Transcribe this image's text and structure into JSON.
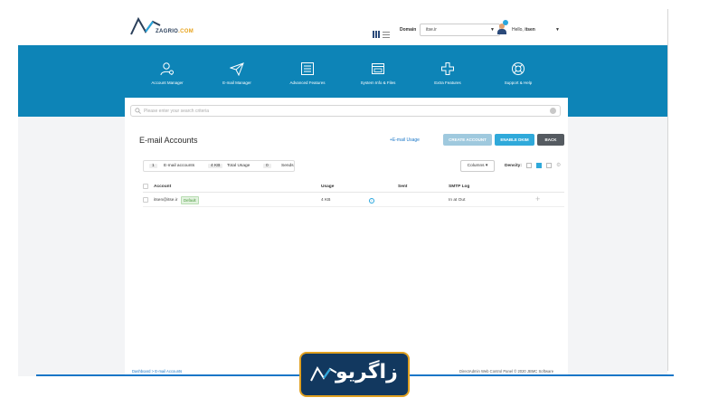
{
  "brand": {
    "logo_text": "ZAGRIO",
    "logo_suffix": ".COM",
    "watermark_text": "زاگریو",
    "colors": {
      "primary": "#0d84b7",
      "accent": "#29a6dd",
      "logo_orange": "#e8a31c",
      "dark": "#555b61"
    }
  },
  "topbar": {
    "view_icons": [
      "grid-icon",
      "list-icon"
    ],
    "domain_label": "Domain",
    "domain_value": "itse.ir",
    "greeting": "Hello,",
    "username": "itsen"
  },
  "nav": {
    "items": [
      {
        "label": "Account Manager",
        "icon": "user-gear-icon"
      },
      {
        "label": "E-mail Manager",
        "icon": "paper-plane-icon"
      },
      {
        "label": "Advanced Features",
        "icon": "list-window-icon"
      },
      {
        "label": "System Info & Files",
        "icon": "folder-window-icon"
      },
      {
        "label": "Extra Features",
        "icon": "plus-icon"
      },
      {
        "label": "Support & Help",
        "icon": "lifebuoy-icon"
      }
    ]
  },
  "search": {
    "placeholder": "Please enter your search criteria"
  },
  "page": {
    "title": "E-mail Accounts",
    "usage_link": "+E-mail Usage",
    "buttons": {
      "create": "CREATE ACCOUNT",
      "dkim": "ENABLE DKIM",
      "back": "BACK"
    }
  },
  "stats": {
    "accounts_count": "1",
    "accounts_label": "E-mail accounts",
    "usage_value": "4 KB",
    "usage_label": "Total Usage",
    "sends_count": "0",
    "sends_label": "Sends"
  },
  "toolbar": {
    "columns_label": "Columns",
    "density_label": "Density:"
  },
  "table": {
    "headers": [
      "Account",
      "Usage",
      "Sent",
      "SMTP Log"
    ],
    "rows": [
      {
        "account": "itsen@itse.ir",
        "badge": "Default",
        "usage": "4 KB",
        "smtp_log": "In at Out"
      }
    ]
  },
  "footer": {
    "breadcrumb": "Dashboard > E-mail Accounts",
    "copyright": "DirectAdmin Web Control Panel © 2020 JBMC Software"
  }
}
